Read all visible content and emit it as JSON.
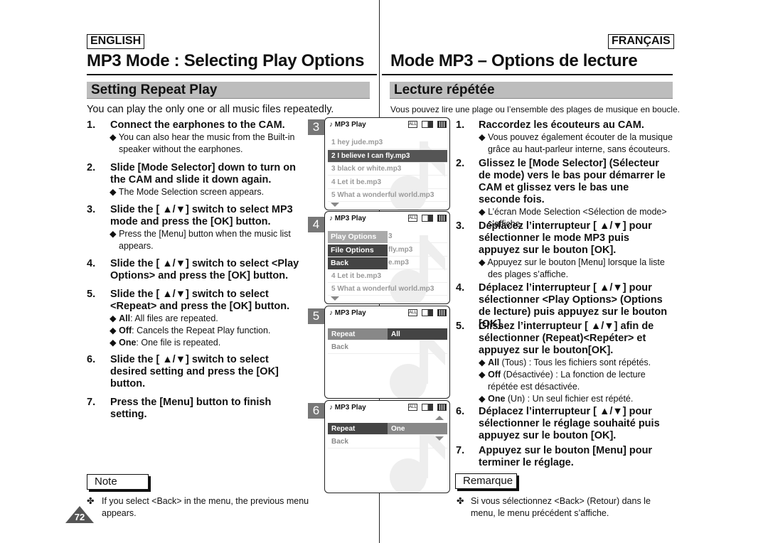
{
  "header": {
    "english": "ENGLISH",
    "french": "FRANÇAIS"
  },
  "en": {
    "title": "MP3 Mode : Selecting Play Options",
    "section": "Setting Repeat Play",
    "intro": "You can play the only one or all music files repeatedly.",
    "steps": [
      {
        "num": "1.",
        "text": "Connect the earphones to the CAM.",
        "bullets": [
          "◆ You can also hear the music from the Built-in speaker without the earphones."
        ]
      },
      {
        "num": "2.",
        "text": "Slide [Mode Selector] down to turn on the CAM and slide it down again.",
        "bullets": [
          "◆ The Mode Selection screen appears."
        ]
      },
      {
        "num": "3.",
        "text": "Slide the [ ▲/▼] switch to select MP3 mode and press the [OK] button.",
        "bullets": [
          "◆ Press the [Menu] button when the music list appears."
        ]
      },
      {
        "num": "4.",
        "text": "Slide the [ ▲/▼] switch to select <Play Options> and press the [OK] button.",
        "bullets": []
      },
      {
        "num": "5.",
        "text": "Slide the [ ▲/▼] switch to select <Repeat> and press the [OK] button.",
        "bullets": [
          {
            "b": "All",
            "t": ": All files are repeated."
          },
          {
            "b": "Off",
            "t": ": Cancels the Repeat Play function."
          },
          {
            "b": "One",
            "t": ": One file is repeated."
          }
        ]
      },
      {
        "num": "6.",
        "text": "Slide the [ ▲/▼] switch to select desired setting and press the [OK] button.",
        "bullets": []
      },
      {
        "num": "7.",
        "text": "Press the [Menu] button to finish setting.",
        "bullets": []
      }
    ],
    "note_label": "Note",
    "note": "If you select <Back> in the menu, the previous menu appears.",
    "note_bullet": "✤"
  },
  "fr": {
    "title": "Mode MP3 – Options de lecture",
    "section": "Lecture répétée",
    "intro": "Vous pouvez lire une plage ou l’ensemble des plages de musique en boucle.",
    "steps": [
      {
        "num": "1.",
        "text": "Raccordez les écouteurs au CAM.",
        "bullets": [
          "◆ Vous pouvez également écouter de la musique grâce au haut-parleur interne, sans écouteurs."
        ]
      },
      {
        "num": "2.",
        "text": "Glissez le [Mode Selector] (Sélecteur de mode) vers le bas pour démarrer le CAM et glissez vers le bas une seconde fois.",
        "bullets": [
          "◆ L’écran Mode Selection <Sélection de mode> s’affiche."
        ]
      },
      {
        "num": "3.",
        "text": "Déplacez l’interrupteur [ ▲/▼] pour sélectionner le mode MP3 puis appuyez sur le bouton [OK].",
        "bullets": [
          "◆ Appuyez sur le bouton [Menu] lorsque la liste des plages s’affiche."
        ]
      },
      {
        "num": "4.",
        "text": "Déplacez l’interrupteur [ ▲/▼] pour sélectionner <Play Options> (Options de lecture) puis appuyez sur le bouton [OK].",
        "bullets": []
      },
      {
        "num": "5.",
        "text": "Glissez l’interrupteur [ ▲/▼] afin de sélectionner (Repeat)<Repéter> et appuyez sur le bouton[OK].",
        "bullets": [
          {
            "b": "All",
            "t": " (Tous) : Tous les fichiers sont répétés."
          },
          {
            "b": "Off",
            "t": " (Désactivée) : La fonction de lecture répétée est désactivée."
          },
          {
            "b": "One",
            "t": " (Un) : Un seul fichier est répété."
          }
        ]
      },
      {
        "num": "6.",
        "text": "Déplacez l’interrupteur [ ▲/▼] pour sélectionner le réglage souhaité puis appuyez sur le bouton [OK].",
        "bullets": []
      },
      {
        "num": "7.",
        "text": "Appuyez sur le bouton [Menu] pour terminer le réglage.",
        "bullets": []
      }
    ],
    "note_label": "Remarque",
    "note": "Si vous sélectionnez <Back> (Retour) dans le menu, le menu précédent s’affiche.",
    "note_bullet": "✤"
  },
  "page_number": "72",
  "screens": {
    "title": "♪ MP3 Play",
    "repeat_icon": "ALL",
    "s3": {
      "num": "3",
      "rows": [
        "1  hey jude.mp3",
        "2  I believe I can fly.mp3",
        "3  black or white.mp3",
        "4  Let it be.mp3",
        "5  What a wonderful world.mp3"
      ]
    },
    "s4": {
      "num": "4",
      "menu": [
        "Play Options",
        "File Options",
        "Back"
      ],
      "rows": [
        "3",
        "fly.mp3",
        "e.mp3",
        "4  Let it be.mp3",
        "5  What a wonderful world.mp3"
      ]
    },
    "s5": {
      "num": "5",
      "label": "Repeat",
      "value": "All",
      "back": "Back"
    },
    "s6": {
      "num": "6",
      "label": "Repeat",
      "value": "One",
      "back": "Back"
    }
  }
}
